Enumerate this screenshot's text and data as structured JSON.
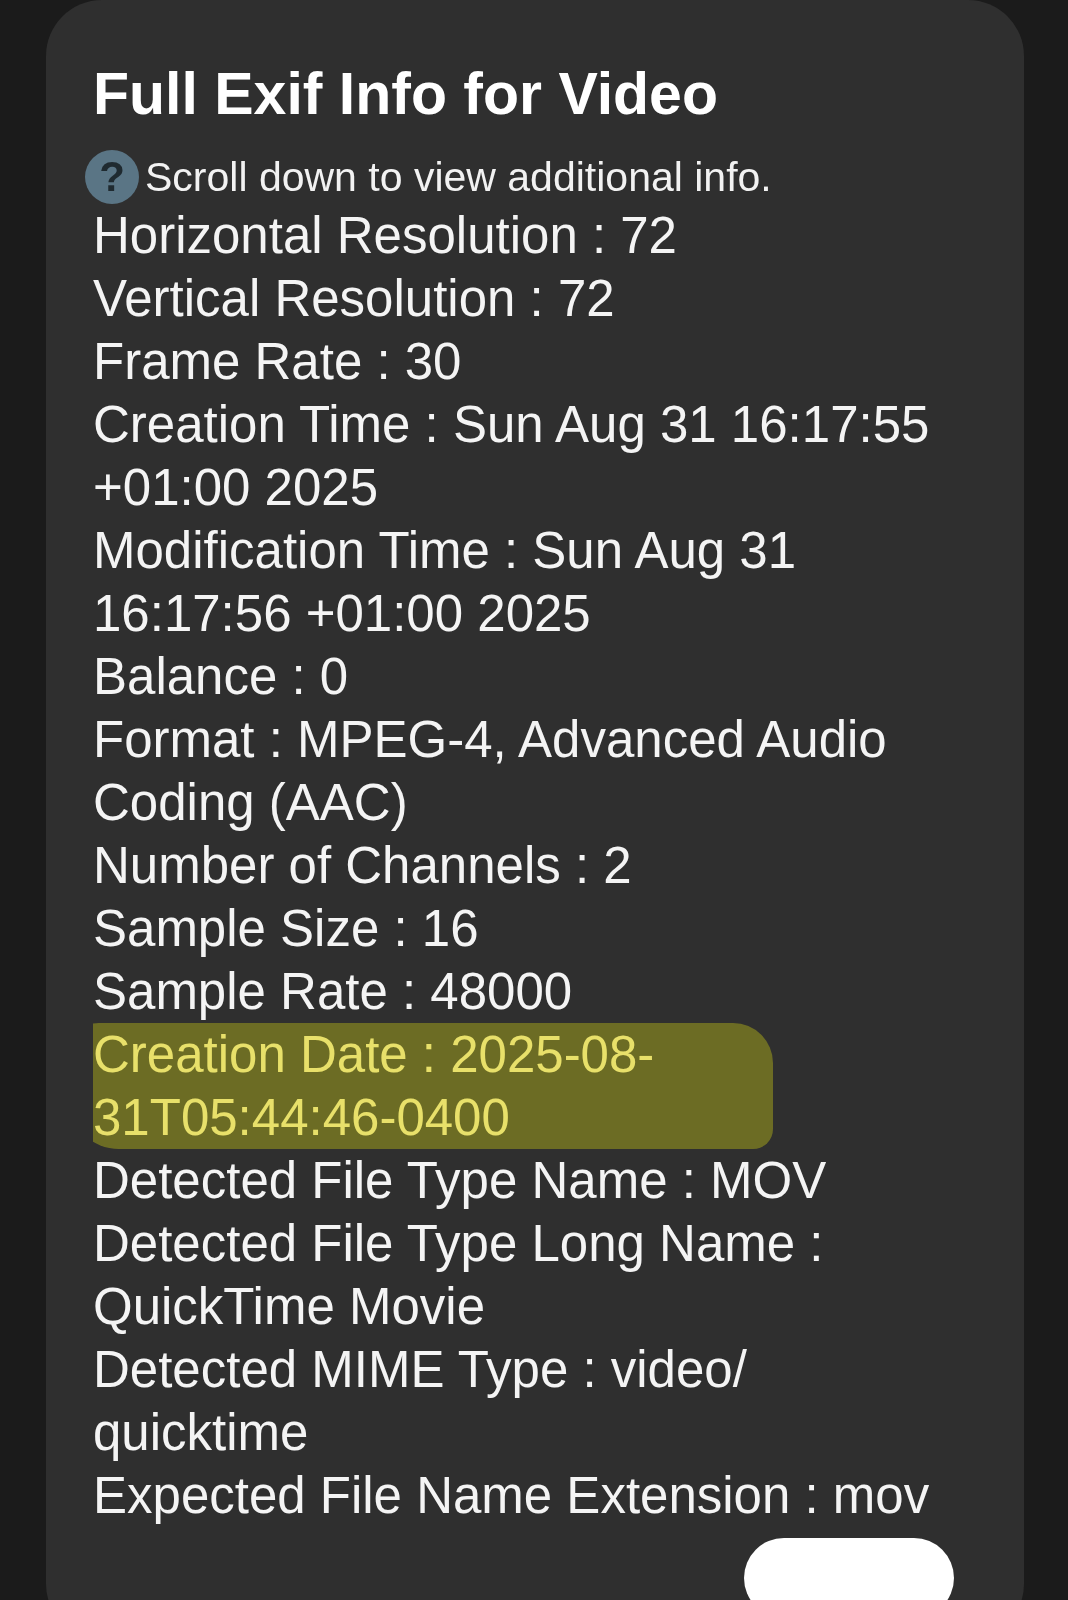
{
  "dialog": {
    "title": "Full Exif Info for Video",
    "hint": {
      "icon": "?",
      "text": "Scroll down to view additional info."
    },
    "rows": [
      {
        "text": "Horizontal Resolution : 72",
        "highlighted": false
      },
      {
        "text": "Vertical Resolution : 72",
        "highlighted": false
      },
      {
        "text": "Frame Rate : 30",
        "highlighted": false
      },
      {
        "text": "Creation Time : Sun Aug 31 16:17:55 +01:00 2025",
        "highlighted": false
      },
      {
        "text": "Modification Time : Sun Aug 31 16:17:56 +01:00 2025",
        "highlighted": false
      },
      {
        "text": "Balance : 0",
        "highlighted": false
      },
      {
        "text": "Format : MPEG-4, Advanced Audio Coding (AAC)",
        "highlighted": false
      },
      {
        "text": "Number of Channels : 2",
        "highlighted": false
      },
      {
        "text": "Sample Size : 16",
        "highlighted": false
      },
      {
        "text": "Sample Rate : 48000",
        "highlighted": false
      },
      {
        "text": "Creation Date : 2025-08-31T05:44:46-0400",
        "highlighted": true
      },
      {
        "text": "Detected File Type Name : MOV",
        "highlighted": false
      },
      {
        "text": "Detected File Type Long Name : QuickTime Movie",
        "highlighted": false
      },
      {
        "text": "Detected MIME Type : video/ quicktime",
        "highlighted": false
      },
      {
        "text": "Expected File Name Extension : mov",
        "highlighted": false
      }
    ]
  }
}
